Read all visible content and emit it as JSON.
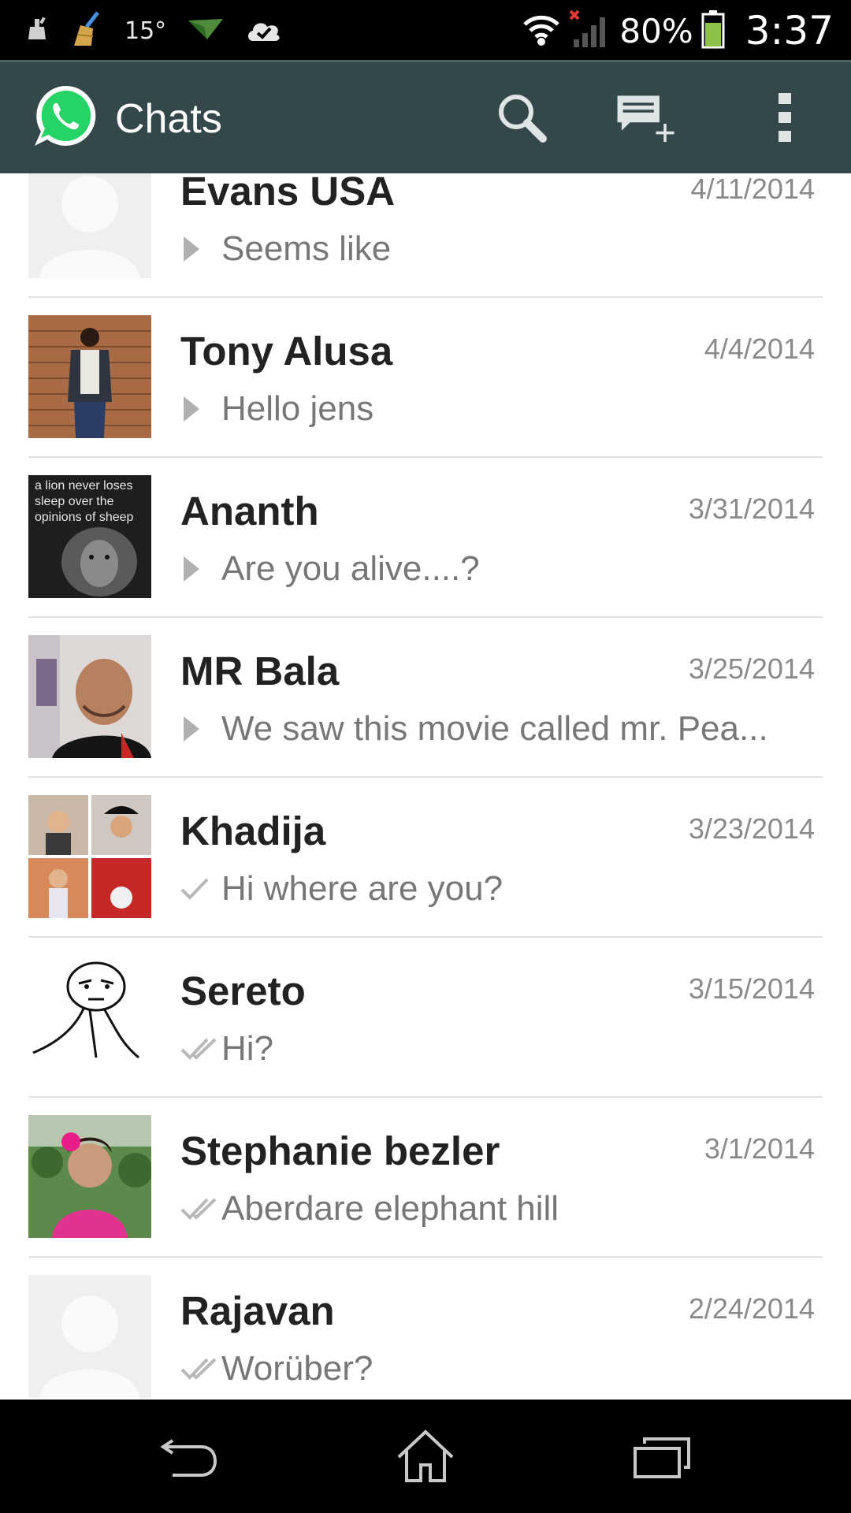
{
  "status_bar": {
    "temperature": "15°",
    "battery_percent": "80%",
    "time": "3:37",
    "battery_level": 0.8
  },
  "action_bar": {
    "title": "Chats",
    "icons": [
      "whatsapp-logo",
      "search-icon",
      "new-chat-icon",
      "overflow-menu-icon"
    ]
  },
  "chats": [
    {
      "name": "Evans USA",
      "date": "4/11/2014",
      "preview": "Seems like",
      "status": "played"
    },
    {
      "name": "Tony Alusa",
      "date": "4/4/2014",
      "preview": "Hello jens",
      "status": "played"
    },
    {
      "name": "Ananth",
      "date": "3/31/2014",
      "preview": "Are you alive....?",
      "status": "played",
      "avatar_text": "a lion never loses sleep over the opinions of sheep"
    },
    {
      "name": "MR Bala",
      "date": "3/25/2014",
      "preview": "We saw this movie called mr. Pea...",
      "status": "played"
    },
    {
      "name": "Khadija",
      "date": "3/23/2014",
      "preview": "Hi where are you?",
      "status": "sent"
    },
    {
      "name": "Sereto",
      "date": "3/15/2014",
      "preview": "Hi?",
      "status": "delivered"
    },
    {
      "name": "Stephanie bezler",
      "date": "3/1/2014",
      "preview": "Aberdare elephant hill",
      "status": "delivered"
    },
    {
      "name": "Rajavan",
      "date": "2/24/2014",
      "preview": "Worüber?",
      "status": "delivered"
    }
  ],
  "colors": {
    "action_bar": "#34474a",
    "whatsapp_green": "#25d366",
    "divider": "#e1e1e1",
    "battery_green": "#8bc34a",
    "no_signal_red": "#e53935"
  }
}
